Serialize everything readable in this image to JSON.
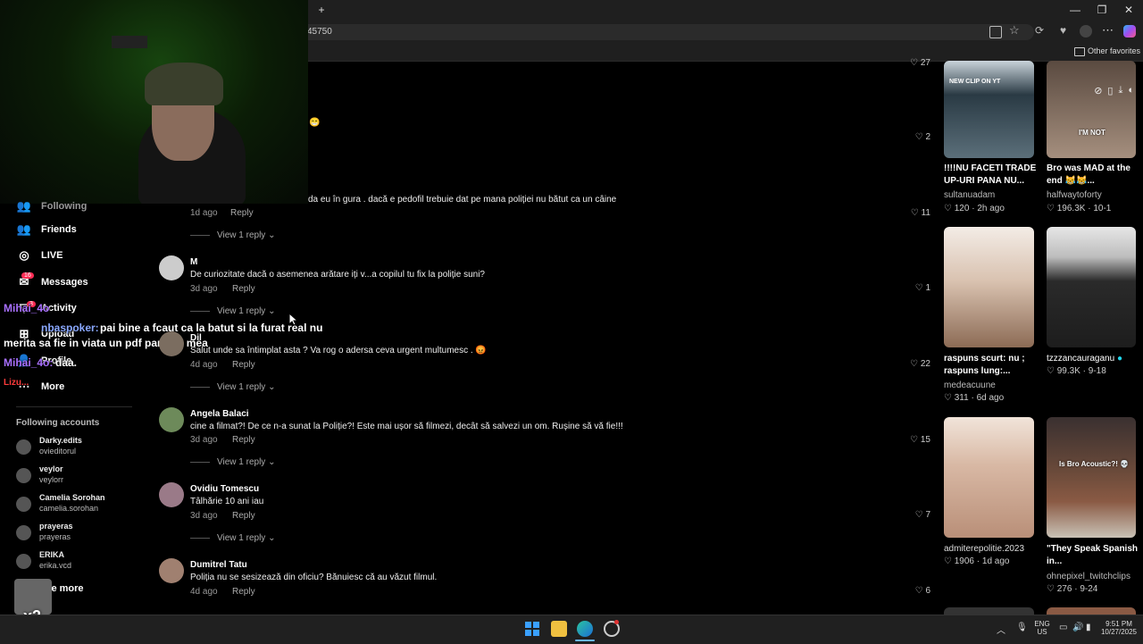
{
  "browser": {
    "address_text": "45750",
    "other_favorites": "Other favorites",
    "new_tab_symbol": "+",
    "window_controls": [
      "—",
      "❐",
      "✕"
    ]
  },
  "sidebar": {
    "nav": [
      {
        "label": "Following",
        "icon": "following-icon"
      },
      {
        "label": "Friends",
        "icon": "friends-icon"
      },
      {
        "label": "LIVE",
        "icon": "live-icon"
      },
      {
        "label": "Messages",
        "icon": "messages-icon",
        "badge": "16"
      },
      {
        "label": "Activity",
        "icon": "activity-icon",
        "badge": "3"
      },
      {
        "label": "Upload",
        "icon": "upload-icon"
      },
      {
        "label": "Profile",
        "icon": "profile-icon"
      },
      {
        "label": "More",
        "icon": "more-icon"
      }
    ],
    "following_header": "Following accounts",
    "accounts": [
      {
        "name": "Darky.edits",
        "handle": "ovieditorul"
      },
      {
        "name": "veylor",
        "handle": "veylorr"
      },
      {
        "name": "Camelia Sorohan",
        "handle": "camelia.sorohan"
      },
      {
        "name": "prayeras",
        "handle": "prayeras"
      },
      {
        "name": "ERIKA",
        "handle": "erika.vcd"
      }
    ],
    "see_more": "See more"
  },
  "chat": [
    {
      "user": "Mihai_4o",
      "text": ""
    },
    {
      "user": "nbaspoker:",
      "text": "pai bine a fcaut ca la batut si la furat real nu"
    },
    {
      "user": "",
      "text": "merita sa fie in viata un pdf parerea mea"
    },
    {
      "user": "Mihai_4o:",
      "text": "daa."
    },
    {
      "user": "Lizu...",
      "text": ""
    }
  ],
  "multiplier_badge": "x2",
  "comments": [
    {
      "name": "",
      "text": "",
      "date": "",
      "likes": "27",
      "partial_top": true
    },
    {
      "name": "",
      "text": "",
      "date": "",
      "likes": "2"
    },
    {
      "name": "",
      "text": "da eu în gura . dacă e pedofil trebuie dat pe mana poliției nu bătut ca un câine",
      "date": "1d ago",
      "likes": "11",
      "view_replies": "View 1 reply"
    },
    {
      "name": "M",
      "text": "De curiozitate dacă o asemenea arătare iți v...a copilul tu fix la poliție suni?",
      "date": "3d ago",
      "likes": "1",
      "view_replies": "View 1 reply"
    },
    {
      "name": "Dil",
      "text": "Salut unde sa întimplat asta ? Va rog o adersa ceva urgent multumesc . 😡",
      "date": "4d ago",
      "likes": "22",
      "view_replies": "View 1 reply"
    },
    {
      "name": "Angela Balaci",
      "text": "cine a filmat?! De ce n-a sunat la Poliție?! Este mai ușor să filmezi, decât să salvezi un om. Rușine să vă fie!!!",
      "date": "3d ago",
      "likes": "15",
      "view_replies": "View 1 reply"
    },
    {
      "name": "Ovidiu Tomescu",
      "text": "Tâlhărie 10 ani iau",
      "date": "3d ago",
      "likes": "7",
      "view_replies": "View 1 reply"
    },
    {
      "name": "Dumitrel Tatu",
      "text": "Poliția nu se sesizează din oficiu? Bănuiesc că au văzut filmul.",
      "date": "4d ago",
      "likes": "6"
    }
  ],
  "reply_label": "Reply",
  "videos": [
    {
      "title": "!!!!NU FACETI TRADE UP-URI PANA NU...",
      "author": "sultanuadam",
      "likes": "120",
      "age": "2h ago",
      "thumb_text": "NEW CLIP ON YT",
      "colors": [
        "#2a3a44",
        "#5b6f7a"
      ]
    },
    {
      "title": "Bro was MAD at the end 😹😹...",
      "author": "halfwaytoforty",
      "likes": "196.3K",
      "age": "10-1",
      "thumb_text": "I'M NOT",
      "colors": [
        "#5a4a40",
        "#a58f7e"
      ]
    },
    {
      "title": "raspuns scurt: nu ; raspuns lung:...",
      "author": "medeacuune",
      "likes": "311",
      "age": "6d ago",
      "thumb_text": "",
      "colors": [
        "#d9c2b0",
        "#8c6b55"
      ]
    },
    {
      "title": "tzzzancauraganu",
      "author": "",
      "likes": "99.3K",
      "age": "9-18",
      "thumb_text": "",
      "colors": [
        "#e6e6e6",
        "#2a2a2a"
      ]
    },
    {
      "title": "admiterepolitie.2023",
      "author": "",
      "likes": "1906",
      "age": "1d ago",
      "thumb_text": "",
      "colors": [
        "#d8b8a4",
        "#f1e4da"
      ]
    },
    {
      "title": "\"They Speak Spanish in...",
      "author": "ohnepixel_twitchclips",
      "likes": "276",
      "age": "9-24",
      "thumb_text": "Is Bro Acoustic?! 💀",
      "colors": [
        "#3a3030",
        "#8a5a44"
      ]
    }
  ],
  "taskbar": {
    "lang": "ENG",
    "region": "US",
    "time": "9:51 PM",
    "date": "10/27/2025"
  }
}
